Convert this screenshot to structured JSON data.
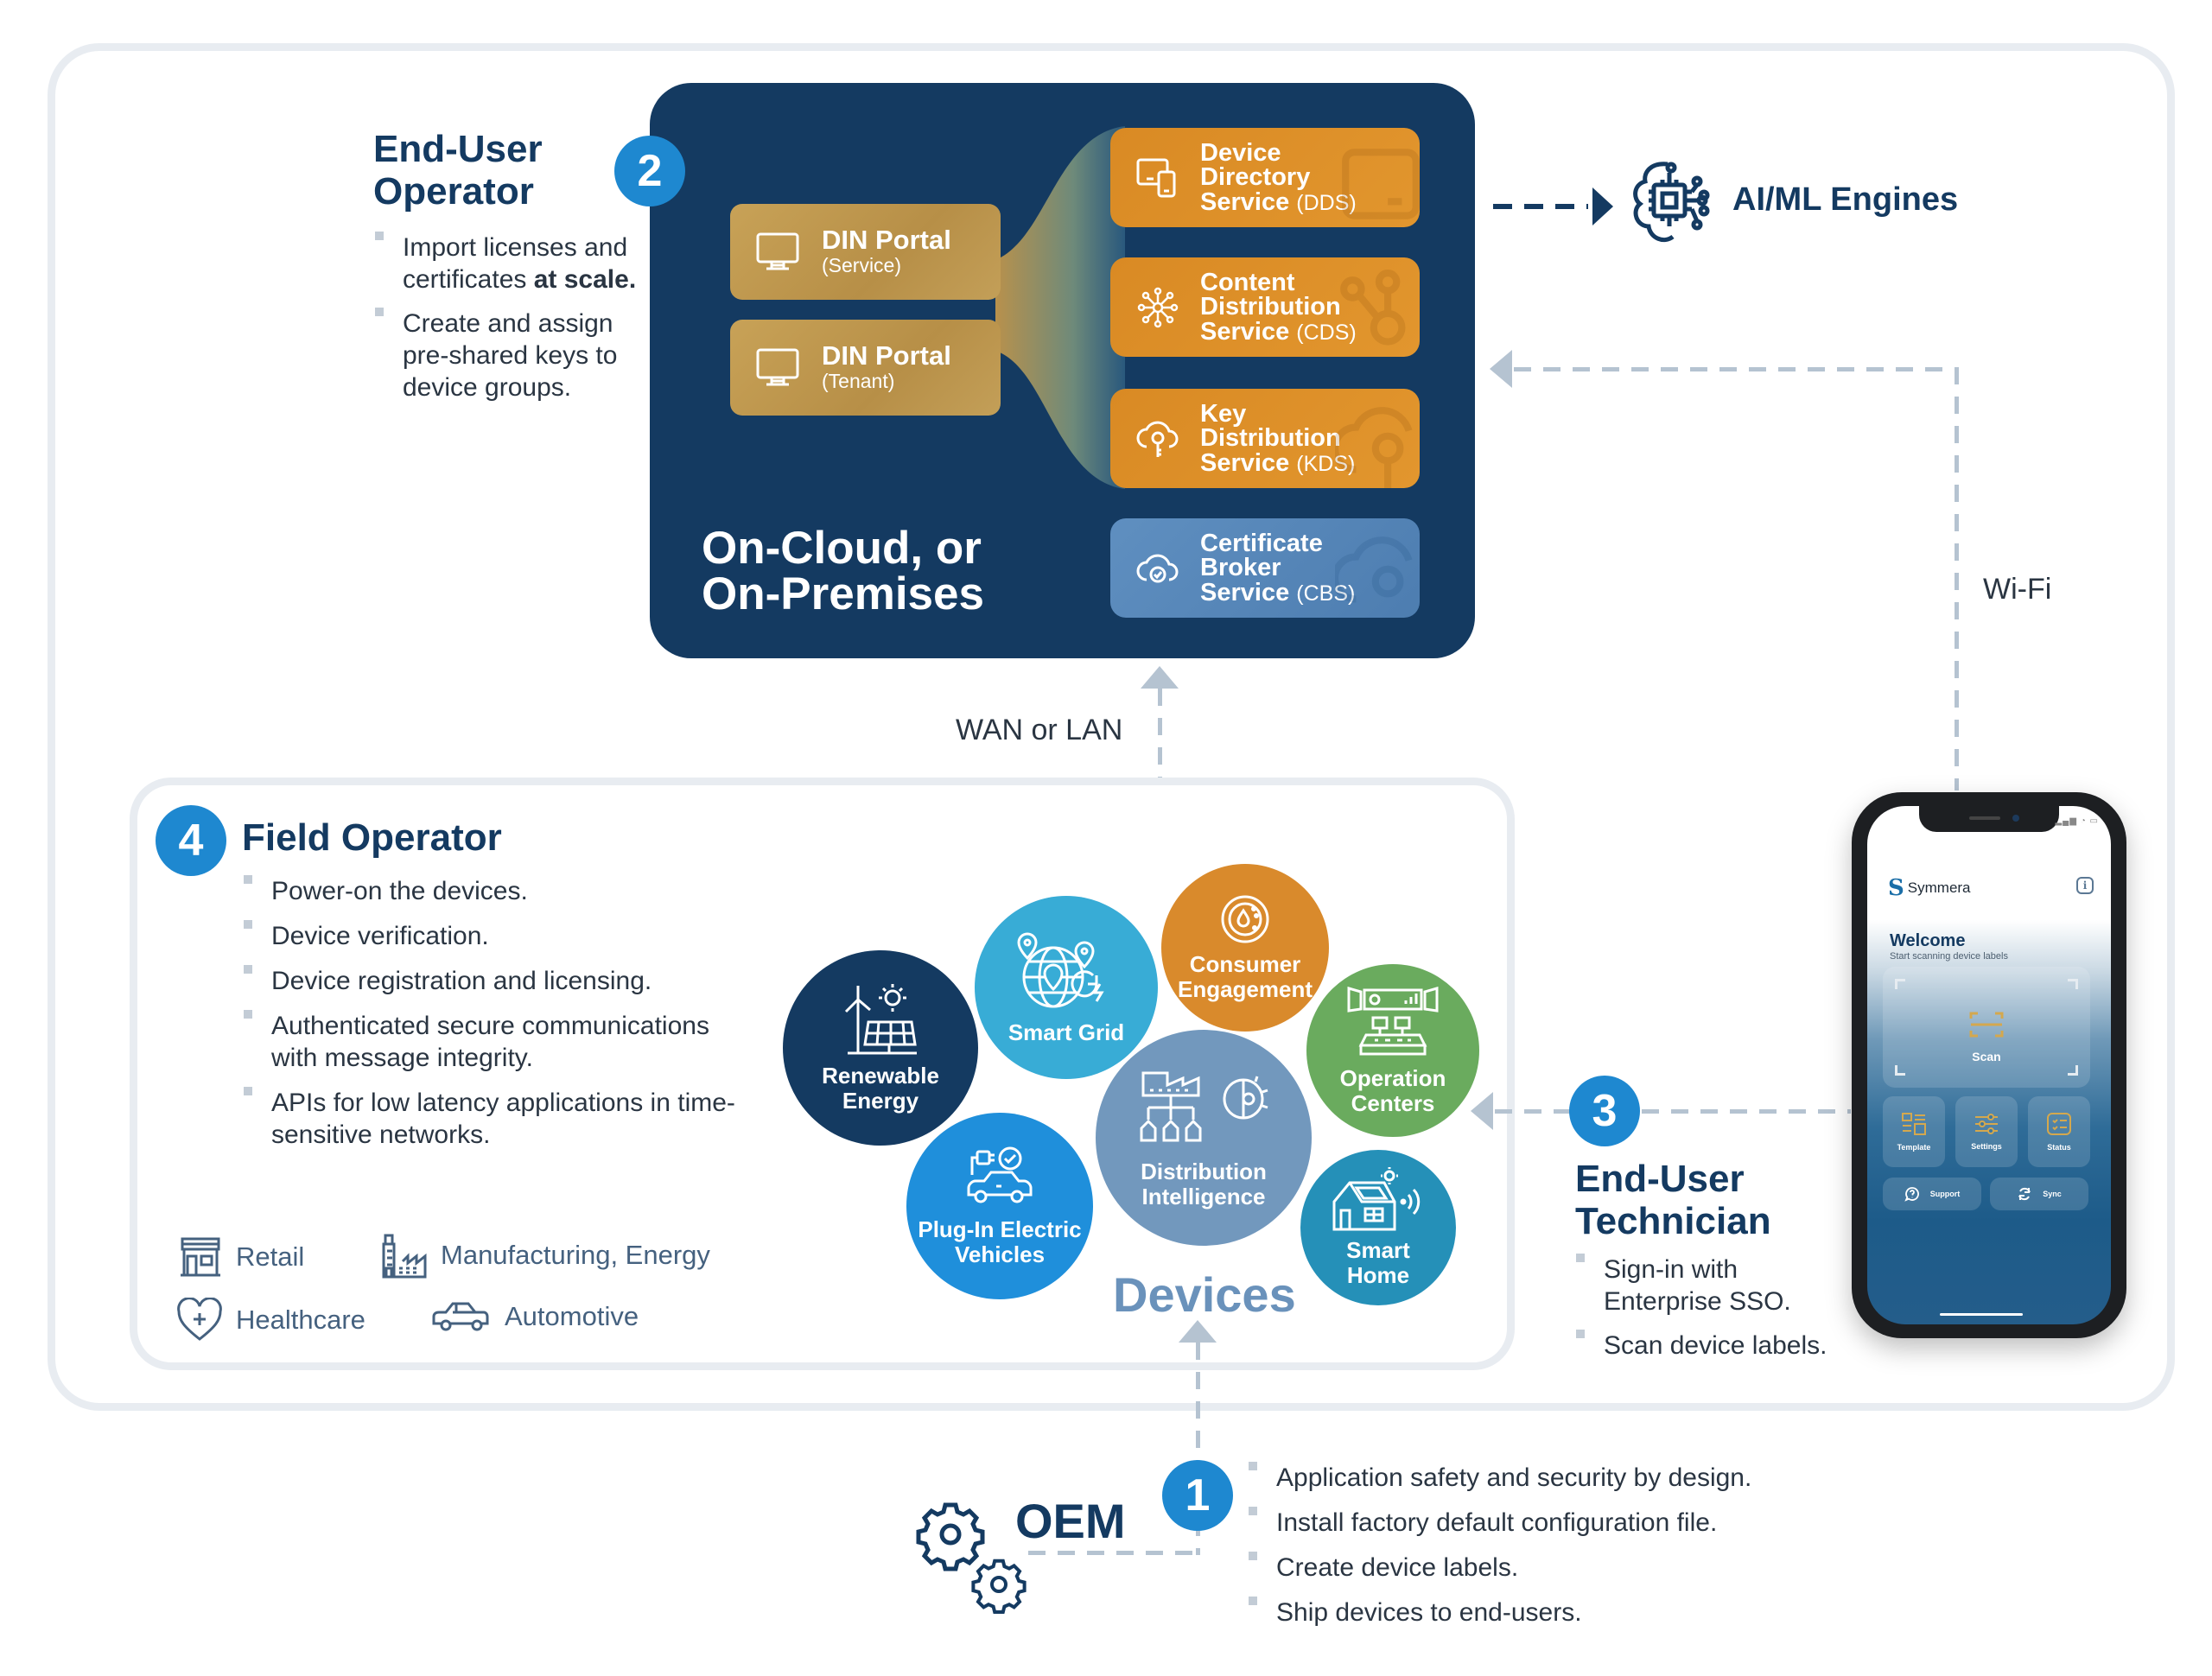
{
  "end_user_operator": {
    "badge": "2",
    "title_line1": "End-User",
    "title_line2": "Operator",
    "bullets": [
      {
        "text": "Import licenses and certificates",
        "bold": "at scale."
      },
      {
        "text": "Create and assign pre-shared keys to device groups.",
        "bold": ""
      }
    ]
  },
  "cloud": {
    "label_line1": "On-Cloud, or",
    "label_line2": "On-Premises",
    "portals": [
      {
        "title": "DIN Portal",
        "subtitle": "(Service)",
        "icon": "monitor-icon"
      },
      {
        "title": "DIN Portal",
        "subtitle": "(Tenant)",
        "icon": "monitor-icon"
      }
    ],
    "services": [
      {
        "line1": "Device",
        "line2": "Directory",
        "line3": "Service",
        "abbr": "(DDS)",
        "icon": "devices-icon",
        "color": "#dd8e28"
      },
      {
        "line1": "Content",
        "line2": "Distribution",
        "line3": "Service",
        "abbr": "(CDS)",
        "icon": "network-hub-icon",
        "color": "#dd8e28"
      },
      {
        "line1": "Key",
        "line2": "Distribution",
        "line3": "Service",
        "abbr": "(KDS)",
        "icon": "cloud-key-icon",
        "color": "#dd8e28"
      },
      {
        "line1": "Certificate",
        "line2": "Broker",
        "line3": "Service",
        "abbr": "(CBS)",
        "icon": "cloud-badge-icon",
        "color": "#5787b9"
      }
    ]
  },
  "ai_ml": {
    "label": "AI/ML Engines",
    "icon": "ai-chip-brain-icon"
  },
  "connections": {
    "wan_lan": "WAN or LAN",
    "wifi": "Wi-Fi"
  },
  "field_operator": {
    "badge": "4",
    "title": "Field Operator",
    "bullets": [
      "Power-on the devices.",
      "Device verification.",
      "Device registration and licensing.",
      "Authenticated secure communications with message integrity.",
      "APIs for low latency applications in time-sensitive networks."
    ],
    "industries": [
      {
        "label": "Retail",
        "icon": "storefront-icon"
      },
      {
        "label": "Manufacturing, Energy",
        "icon": "factory-icon"
      },
      {
        "label": "Healthcare",
        "icon": "heart-plus-icon"
      },
      {
        "label": "Automotive",
        "icon": "car-icon"
      }
    ]
  },
  "devices": {
    "label": "Devices",
    "bubbles": [
      {
        "line1": "Renewable",
        "line2": "Energy",
        "color": "#143a61",
        "icon": "wind-solar-icon"
      },
      {
        "line1": "Smart Grid",
        "line2": "",
        "color": "#38acd6",
        "icon": "globe-pins-icon"
      },
      {
        "line1": "Consumer",
        "line2": "Engagement",
        "color": "#d98a2c",
        "icon": "meter-drop-icon"
      },
      {
        "line1": "Operation",
        "line2": "Centers",
        "color": "#6aab5e",
        "icon": "control-room-icon"
      },
      {
        "line1": "Distribution",
        "line2": "Intelligence",
        "color": "#7298bd",
        "icon": "factory-network-icon"
      },
      {
        "line1": "Plug-In Electric",
        "line2": "Vehicles",
        "color": "#1f8fdb",
        "icon": "ev-charging-icon"
      },
      {
        "line1": "Smart",
        "line2": "Home",
        "color": "#2590b8",
        "icon": "smart-home-icon"
      }
    ]
  },
  "technician": {
    "badge": "3",
    "title_line1": "End-User",
    "title_line2": "Technician",
    "bullets": [
      "Sign-in with Enterprise SSO.",
      "Scan device labels."
    ]
  },
  "phone_app": {
    "brand": "Symmera",
    "welcome": "Welcome",
    "welcome_sub": "Start scanning device labels",
    "scan": "Scan",
    "tiles": [
      "Template",
      "Settings",
      "Status"
    ],
    "buttons": [
      "Support",
      "Sync"
    ]
  },
  "oem": {
    "badge": "1",
    "title": "OEM",
    "bullets": [
      "Application safety and security by design.",
      "Install factory default configuration file.",
      "Create device labels.",
      "Ship devices to end-users."
    ]
  },
  "colors": {
    "navy": "#143a61",
    "accent_blue": "#1e88d0",
    "orange": "#dd8e28",
    "gold": "#c29a50",
    "connector": "#b5c3d1"
  }
}
